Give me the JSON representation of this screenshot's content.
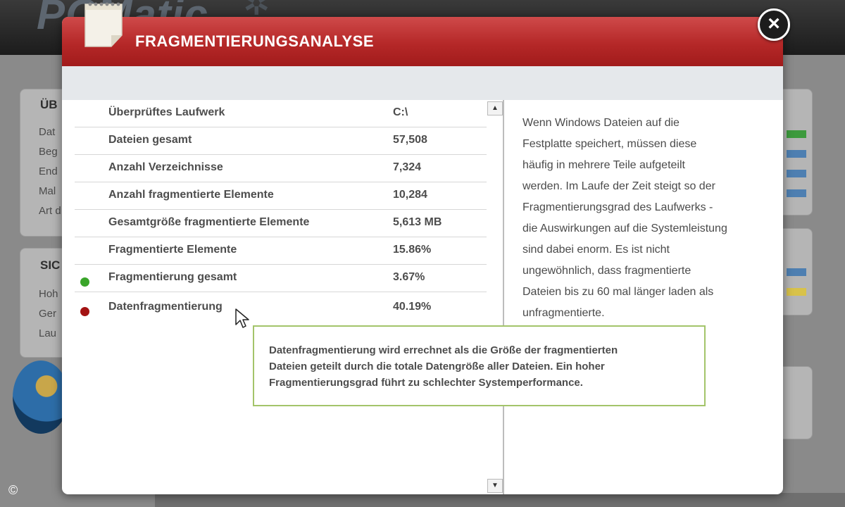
{
  "app": {
    "logo_text": "PCMatic"
  },
  "background_panels": {
    "panel1": {
      "title": "ÜB",
      "lines": [
        "Dat",
        "Beg",
        "End",
        "Mal",
        "Art d"
      ]
    },
    "panel2": {
      "title": "SIC",
      "lines": [
        "Hoh",
        "Ger",
        "Lau"
      ]
    }
  },
  "copyright": "©",
  "modal": {
    "title": "FRAGMENTIERUNGSANALYSE",
    "close_label": "×",
    "stats": [
      {
        "label": "Überprüftes Laufwerk",
        "value": "C:\\",
        "status": ""
      },
      {
        "label": "Dateien gesamt",
        "value": "57,508",
        "status": ""
      },
      {
        "label": "Anzahl Verzeichnisse",
        "value": "7,324",
        "status": ""
      },
      {
        "label": "Anzahl fragmentierte Elemente",
        "value": "10,284",
        "status": ""
      },
      {
        "label": "Gesamtgröße fragmentierte Elemente",
        "value": "5,613 MB",
        "status": ""
      },
      {
        "label": "Fragmentierte Elemente",
        "value": "15.86%",
        "status": ""
      },
      {
        "label": "Fragmentierung gesamt",
        "value": "3.67%",
        "status": "good"
      },
      {
        "label": "Datenfragmentierung",
        "value": "40.19%",
        "status": "bad"
      }
    ],
    "description_lines": [
      "Wenn Windows Dateien auf die",
      "Festplatte speichert, müssen diese",
      "häufig in mehrere Teile aufgeteilt",
      "werden. Im Laufe der Zeit steigt so der",
      "Fragmentierungsgrad des Laufwerks -",
      "die Auswirkungen auf die Systemleistung",
      "sind dabei enorm. Es ist nicht",
      "ungewöhnlich, dass fragmentierte",
      "Dateien bis zu 60 mal länger laden als",
      "unfragmentierte."
    ],
    "tooltip_lines": [
      "Datenfragmentierung wird errechnet als die Größe der fragmentierten",
      "Dateien geteilt durch die totale Datengröße aller Dateien. Ein hoher",
      "Fragmentierungsgrad führt zu schlechter Systemperformance."
    ]
  },
  "colors": {
    "header_red": "#b52828",
    "status_good": "#3aa52a",
    "status_bad": "#a31313",
    "tooltip_border": "#a3c46a"
  },
  "icons": {
    "notepad": "notepad-icon",
    "close": "close-icon",
    "cursor": "mouse-pointer-icon",
    "scroll_up": "scroll-up-arrow-icon",
    "scroll_down": "scroll-down-arrow-icon"
  }
}
